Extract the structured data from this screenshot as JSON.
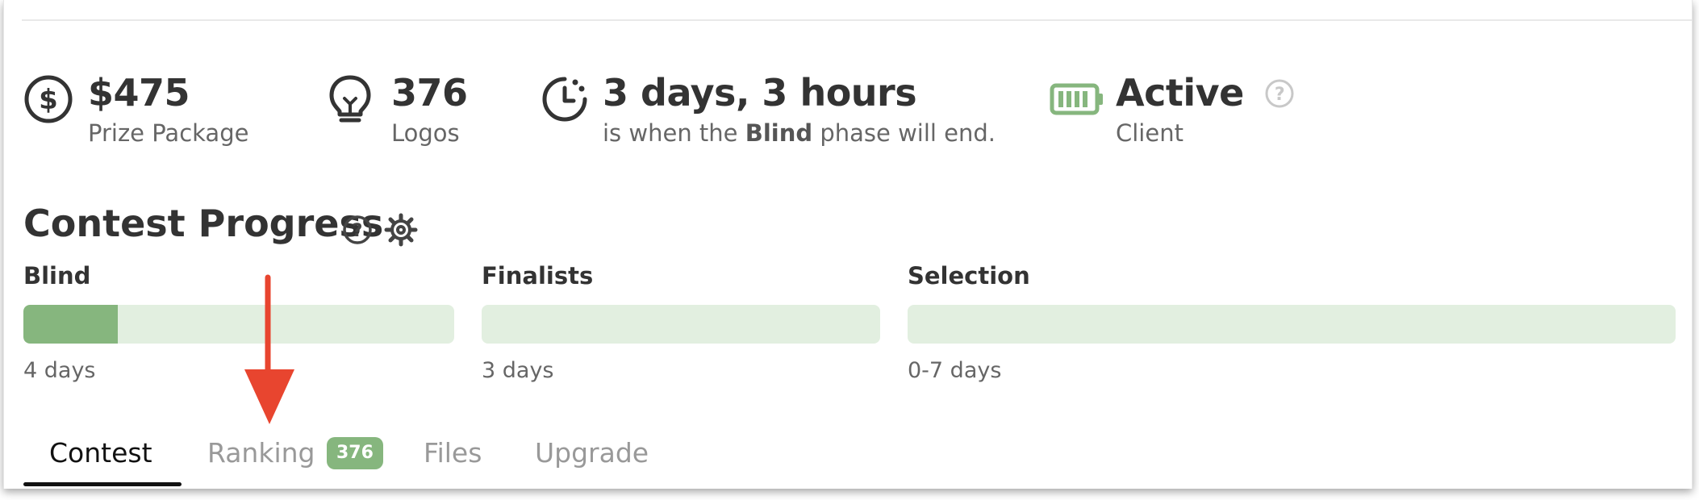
{
  "stats": {
    "prize": {
      "value": "$475",
      "label": "Prize Package",
      "icon": "dollar-circle-icon"
    },
    "logos": {
      "value": "376",
      "label": "Logos",
      "icon": "lightbulb-icon"
    },
    "time": {
      "value": "3 days, 3 hours",
      "label_pre": "is when the",
      "label_bold": "Blind",
      "label_post": "phase will end.",
      "icon": "clock-icon"
    },
    "status": {
      "value": "Active",
      "label": "Client",
      "icon": "battery-icon"
    }
  },
  "progress": {
    "title": "Contest Progress",
    "phases": [
      {
        "name": "Blind",
        "duration": "4 days",
        "fill_fraction": 0.22
      },
      {
        "name": "Finalists",
        "duration": "3 days",
        "fill_fraction": 0
      },
      {
        "name": "Selection",
        "duration": "0-7 days",
        "fill_fraction": 0
      }
    ]
  },
  "tabs": {
    "contest": "Contest",
    "ranking": "Ranking",
    "ranking_count": "376",
    "files": "Files",
    "upgrade": "Upgrade"
  },
  "colors": {
    "accent_green": "#86b67e",
    "track_green": "#e2efe0",
    "arrow_red": "#e8452f"
  }
}
